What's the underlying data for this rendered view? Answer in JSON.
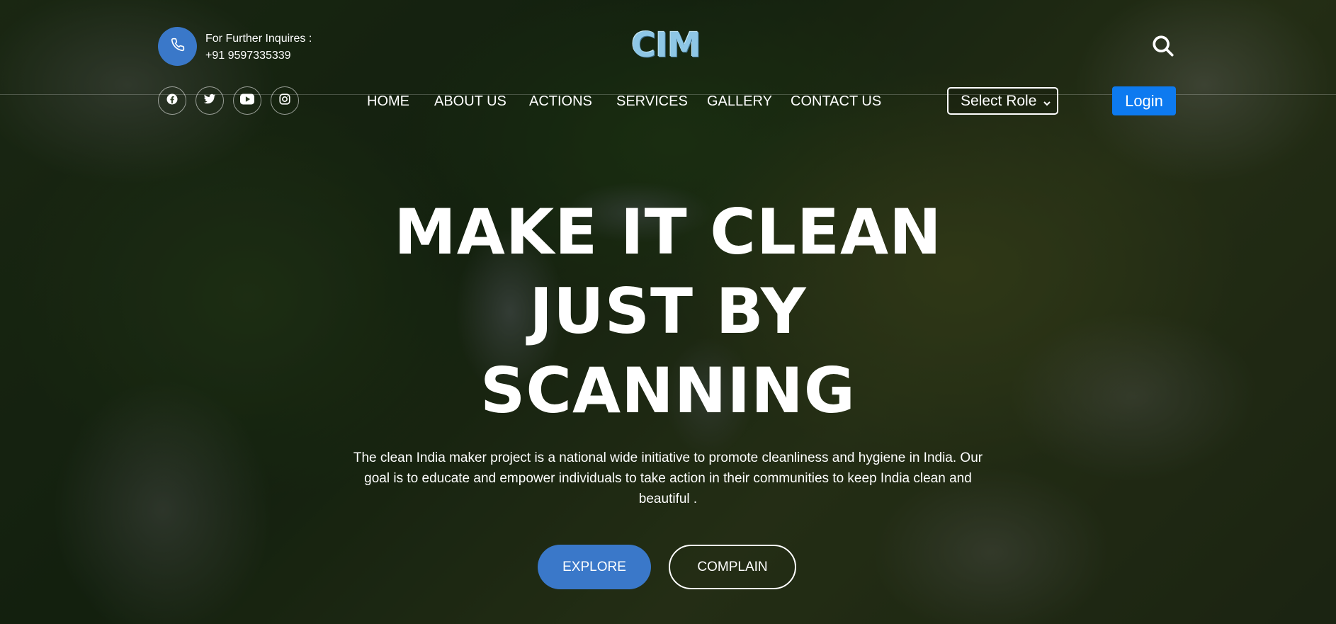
{
  "header": {
    "phone_label": "For Further Inquires :",
    "phone_number": "+91 9597335339",
    "logo_text": "CIM",
    "search_icon": "search-icon"
  },
  "social": [
    {
      "name": "facebook-icon"
    },
    {
      "name": "twitter-icon"
    },
    {
      "name": "youtube-icon"
    },
    {
      "name": "instagram-icon"
    }
  ],
  "nav": {
    "items": [
      {
        "label": "HOME"
      },
      {
        "label": "ABOUT US"
      },
      {
        "label": "ACTIONS"
      },
      {
        "label": "SERVICES"
      },
      {
        "label": "GALLERY"
      },
      {
        "label": "CONTACT US"
      }
    ],
    "role_select": "Select Role",
    "login_label": "Login"
  },
  "hero": {
    "title_lines": [
      "MAKE IT CLEAN",
      "JUST BY",
      "SCANNING"
    ],
    "description": "The clean India maker project is a national wide initiative to promote cleanliness and hygiene in India. Our goal is to educate and empower individuals to take action in their communities to keep India clean and beautiful .",
    "explore_label": "EXPLORE",
    "complain_label": "COMPLAIN"
  },
  "colors": {
    "accent": "#3a78c9",
    "login": "#0d7af0",
    "logo": "#8ec7e6"
  }
}
